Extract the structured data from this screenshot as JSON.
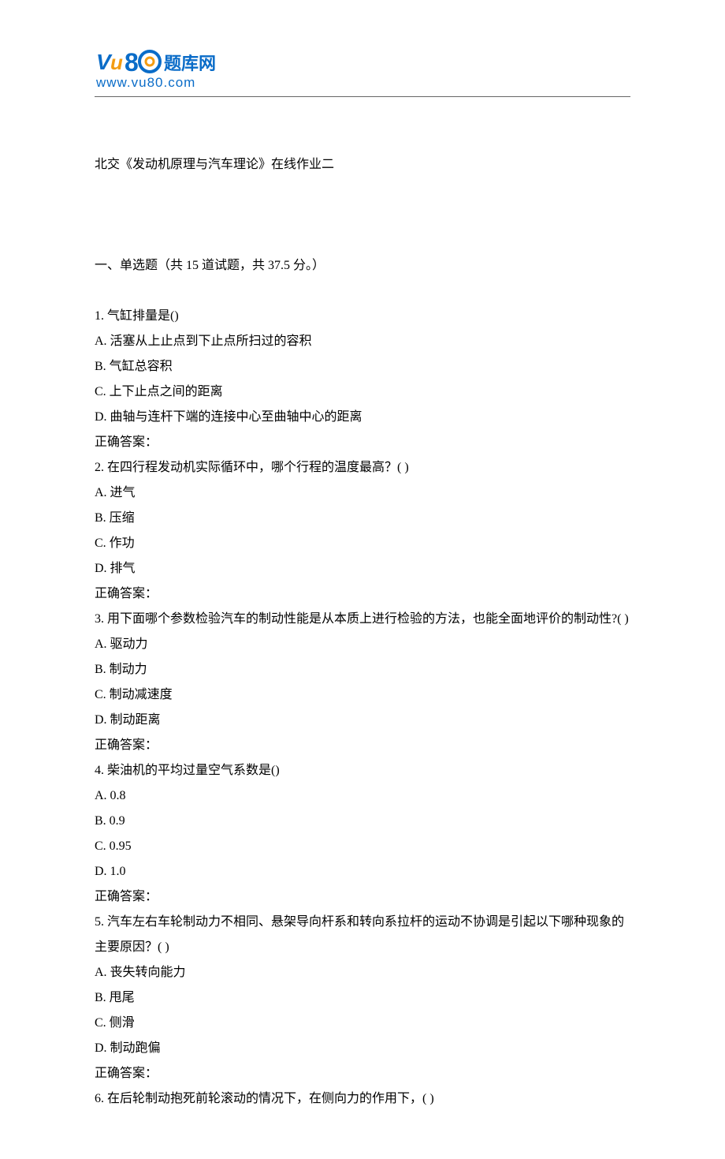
{
  "logo": {
    "brand_text": "题库网",
    "url_text": "www.vu80.com",
    "blue": "#0a6cc8",
    "orange": "#f39c12"
  },
  "title": "北交《发动机原理与汽车理论》在线作业二",
  "section_header": "一、单选题（共 15 道试题，共 37.5 分。）",
  "questions": [
    {
      "stem": "1.   气缸排量是()",
      "options": [
        "A.  活塞从上止点到下止点所扫过的容积",
        "B.  气缸总容积",
        "C.  上下止点之间的距离",
        "D.  曲轴与连杆下端的连接中心至曲轴中心的距离"
      ],
      "answer_label": "正确答案："
    },
    {
      "stem": "2.   在四行程发动机实际循环中，哪个行程的温度最高？( )",
      "options": [
        "A.  进气",
        "B.  压缩",
        "C.  作功",
        "D.  排气"
      ],
      "answer_label": "正确答案："
    },
    {
      "stem": "3.   用下面哪个参数检验汽车的制动性能是从本质上进行检验的方法，也能全面地评价的制动性?( )",
      "options": [
        "A.  驱动力",
        "B.  制动力",
        "C.  制动减速度",
        "D.  制动距离"
      ],
      "answer_label": "正确答案："
    },
    {
      "stem": "4.   柴油机的平均过量空气系数是()",
      "options": [
        "A. 0.8",
        "B. 0.9",
        "C. 0.95",
        "D. 1.0"
      ],
      "answer_label": "正确答案："
    },
    {
      "stem": "5.   汽车左右车轮制动力不相同、悬架导向杆系和转向系拉杆的运动不协调是引起以下哪种现象的主要原因？( )",
      "options": [
        "A.  丧失转向能力",
        "B.  甩尾",
        "C.  侧滑",
        "D.  制动跑偏"
      ],
      "answer_label": "正确答案："
    },
    {
      "stem": "6.   在后轮制动抱死前轮滚动的情况下，在侧向力的作用下，( )",
      "options": [],
      "answer_label": ""
    }
  ]
}
